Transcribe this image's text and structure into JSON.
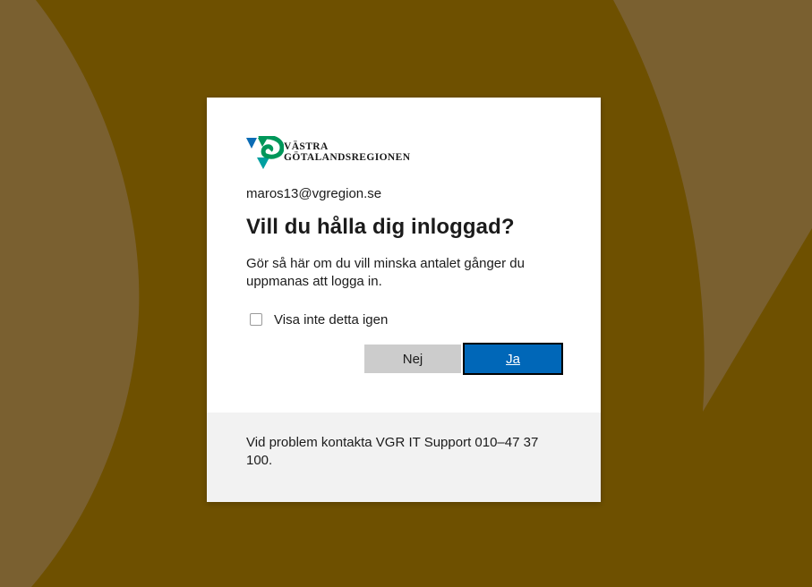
{
  "colors": {
    "background": "#6e5000",
    "background_shape": "#7a6030",
    "primary_button": "#0067b8",
    "secondary_button": "#cccccc",
    "footer_bg": "#f2f2f2"
  },
  "logo": {
    "line1": "VÄSTRA",
    "line2": "GÖTALANDSREGIONEN",
    "icon": "vgr-logo-icon"
  },
  "account": {
    "email": "maros13@vgregion.se"
  },
  "dialog": {
    "title": "Vill du hålla dig inloggad?",
    "description": "Gör så här om du vill minska antalet gånger du uppmanas att logga in.",
    "checkbox_label": "Visa inte detta igen",
    "checkbox_checked": false,
    "no_label": "Nej",
    "yes_label": "Ja"
  },
  "footer": {
    "text": "Vid problem kontakta VGR IT Support 010–47 37 100."
  }
}
